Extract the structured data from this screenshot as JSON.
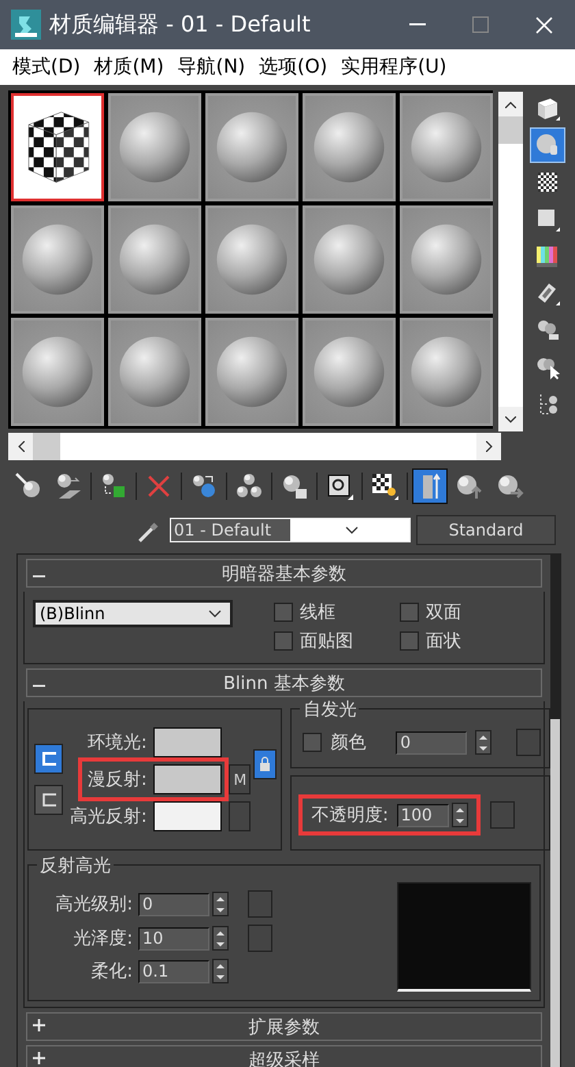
{
  "window": {
    "title": "材质编辑器 - 01 - Default"
  },
  "menu": [
    "模式(D)",
    "材质(M)",
    "导航(N)",
    "选项(O)",
    "实用程序(U)"
  ],
  "sample_slots": [
    {
      "kind": "checker",
      "selected": true
    },
    {
      "kind": "sphere",
      "selected": false
    },
    {
      "kind": "sphere",
      "selected": false
    },
    {
      "kind": "sphere",
      "selected": false
    },
    {
      "kind": "sphere",
      "selected": false
    },
    {
      "kind": "sphere",
      "selected": false
    },
    {
      "kind": "sphere",
      "selected": false
    },
    {
      "kind": "sphere",
      "selected": false
    },
    {
      "kind": "sphere",
      "selected": false
    },
    {
      "kind": "sphere",
      "selected": false
    },
    {
      "kind": "sphere",
      "selected": false
    },
    {
      "kind": "sphere",
      "selected": false
    },
    {
      "kind": "sphere",
      "selected": false
    },
    {
      "kind": "sphere",
      "selected": false
    },
    {
      "kind": "sphere",
      "selected": false
    }
  ],
  "side_tools": [
    {
      "kind": "cube",
      "selected": false
    },
    {
      "kind": "sphere",
      "selected": true
    },
    {
      "kind": "checker",
      "selected": false
    },
    {
      "kind": "square",
      "selected": false
    },
    {
      "kind": "colorbars",
      "selected": false
    },
    {
      "kind": "film",
      "selected": false
    },
    {
      "kind": "options",
      "selected": false
    },
    {
      "kind": "select",
      "selected": false
    },
    {
      "kind": "navigator",
      "selected": false
    }
  ],
  "toolbar": [
    {
      "kind": "get",
      "selected": false
    },
    {
      "kind": "put",
      "selected": false
    },
    {
      "kind": "assign",
      "selected": false
    },
    {
      "kind": "delete",
      "selected": false
    },
    {
      "kind": "copy",
      "selected": false
    },
    {
      "kind": "unique",
      "selected": false
    },
    {
      "kind": "library",
      "selected": false
    },
    {
      "kind": "channel",
      "selected": false
    },
    {
      "kind": "showmap",
      "selected": false
    },
    {
      "kind": "endresult",
      "selected": true
    },
    {
      "kind": "parent",
      "selected": false
    },
    {
      "kind": "sibling",
      "selected": false
    }
  ],
  "material": {
    "name": "01 - Default",
    "type": "Standard"
  },
  "shader_rollout": {
    "title": "明暗器基本参数",
    "expanded": true,
    "shader": "(B)Blinn",
    "options": [
      {
        "label": "线框",
        "checked": false
      },
      {
        "label": "双面",
        "checked": false
      },
      {
        "label": "面贴图",
        "checked": false
      },
      {
        "label": "面状",
        "checked": false
      }
    ]
  },
  "blinn_rollout": {
    "title": "Blinn 基本参数",
    "expanded": true,
    "colors": [
      {
        "label": "环境光:",
        "color": "#c8c8c8",
        "highlighted": false,
        "map": false
      },
      {
        "label": "漫反射:",
        "color": "#c8c8c8",
        "highlighted": true,
        "map": true,
        "map_label": "M"
      },
      {
        "label": "高光反射:",
        "color": "#f2f2f2",
        "highlighted": false,
        "map": true
      }
    ],
    "lock": {
      "on": true
    },
    "self_illumination": {
      "title": "自发光",
      "label": "颜色",
      "checked": false,
      "value": "0"
    },
    "opacity": {
      "label": "不透明度:",
      "value": "100",
      "highlighted": true
    },
    "specular": {
      "title": "反射高光",
      "fields": [
        {
          "label": "高光级别:",
          "value": "0",
          "map": true
        },
        {
          "label": "光泽度:",
          "value": "10",
          "map": true
        },
        {
          "label": "柔化:",
          "value": "0.1",
          "map": false
        }
      ]
    }
  },
  "collapsed_rollouts": [
    {
      "title": "扩展参数",
      "expanded": false
    },
    {
      "title": "超级采样",
      "expanded": false
    }
  ]
}
